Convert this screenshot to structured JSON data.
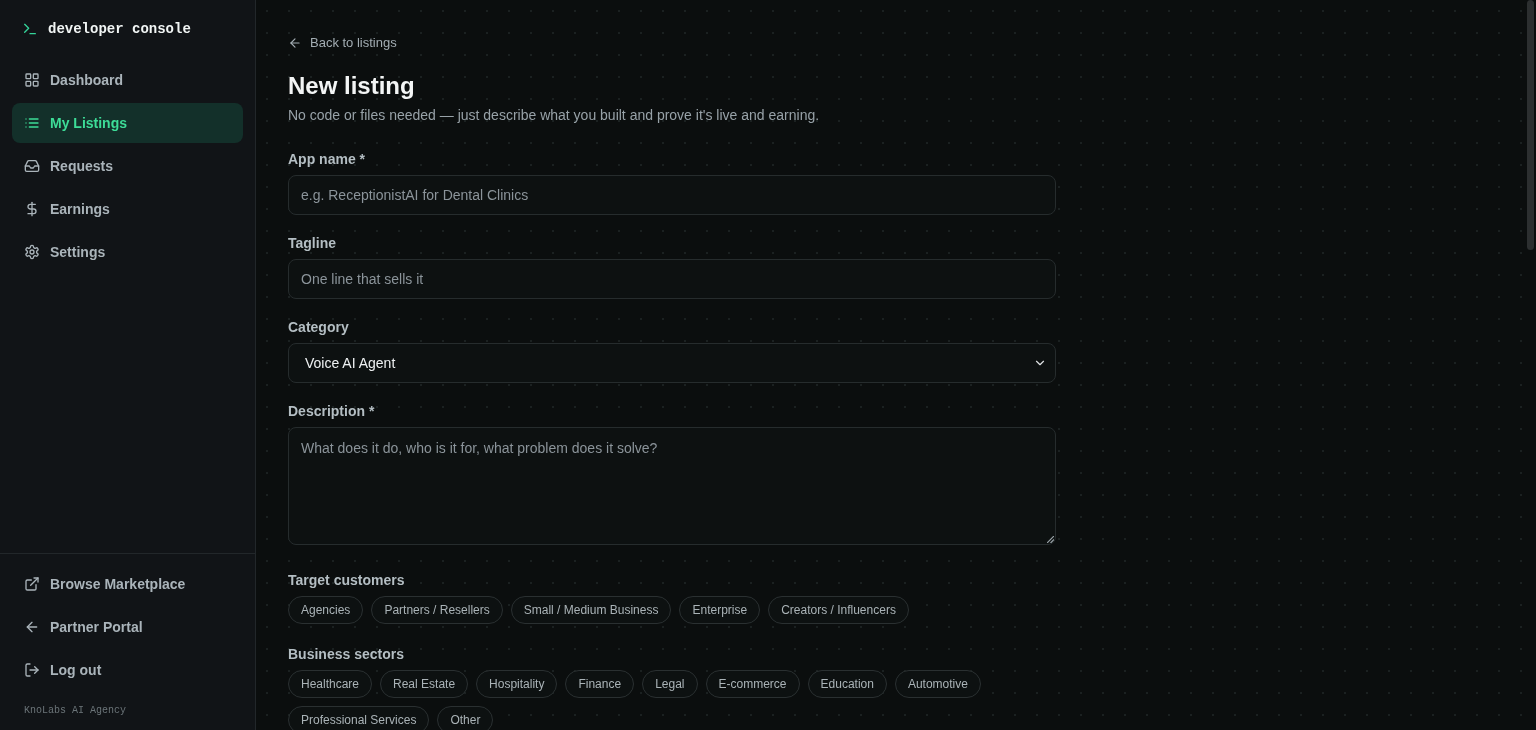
{
  "sidebar": {
    "brand": "developer console",
    "items": [
      {
        "label": "Dashboard",
        "selected": false
      },
      {
        "label": "My Listings",
        "selected": true
      },
      {
        "label": "Requests",
        "selected": false
      },
      {
        "label": "Earnings",
        "selected": false
      },
      {
        "label": "Settings",
        "selected": false
      }
    ],
    "links": [
      {
        "label": "Browse Marketplace"
      },
      {
        "label": "Partner Portal"
      },
      {
        "label": "Log out"
      }
    ],
    "footer": "KnoLabs AI Agency"
  },
  "page": {
    "back_link": "Back to listings",
    "title": "New listing",
    "subtitle": "No code or files needed — just describe what you built and prove it's live and earning.",
    "fields": [
      {
        "kind": "input",
        "label": "App name *",
        "placeholder": "e.g. ReceptionistAI for Dental Clinics"
      },
      {
        "kind": "input",
        "label": "Tagline",
        "placeholder": "One line that sells it"
      },
      {
        "kind": "select",
        "label": "Category",
        "value": "Voice AI Agent"
      },
      {
        "kind": "textarea",
        "label": "Description *",
        "placeholder": "What does it do, who is it for, what problem does it solve?"
      }
    ],
    "chip_groups": [
      {
        "label": "Target customers",
        "chips": [
          {
            "label": "Agencies",
            "selected": false
          },
          {
            "label": "Partners / Resellers",
            "selected": false
          },
          {
            "label": "Small / Medium Business",
            "selected": false
          },
          {
            "label": "Enterprise",
            "selected": false
          },
          {
            "label": "Creators / Influencers",
            "selected": false
          }
        ]
      },
      {
        "label": "Business sectors",
        "chips": [
          {
            "label": "Healthcare",
            "selected": false
          },
          {
            "label": "Real Estate",
            "selected": false
          },
          {
            "label": "Hospitality",
            "selected": false
          },
          {
            "label": "Finance",
            "selected": false
          },
          {
            "label": "Legal",
            "selected": false
          },
          {
            "label": "E-commerce",
            "selected": false
          },
          {
            "label": "Education",
            "selected": false
          },
          {
            "label": "Automotive",
            "selected": false
          },
          {
            "label": "Professional Services",
            "selected": false
          },
          {
            "label": "Other",
            "selected": false
          }
        ]
      }
    ]
  }
}
